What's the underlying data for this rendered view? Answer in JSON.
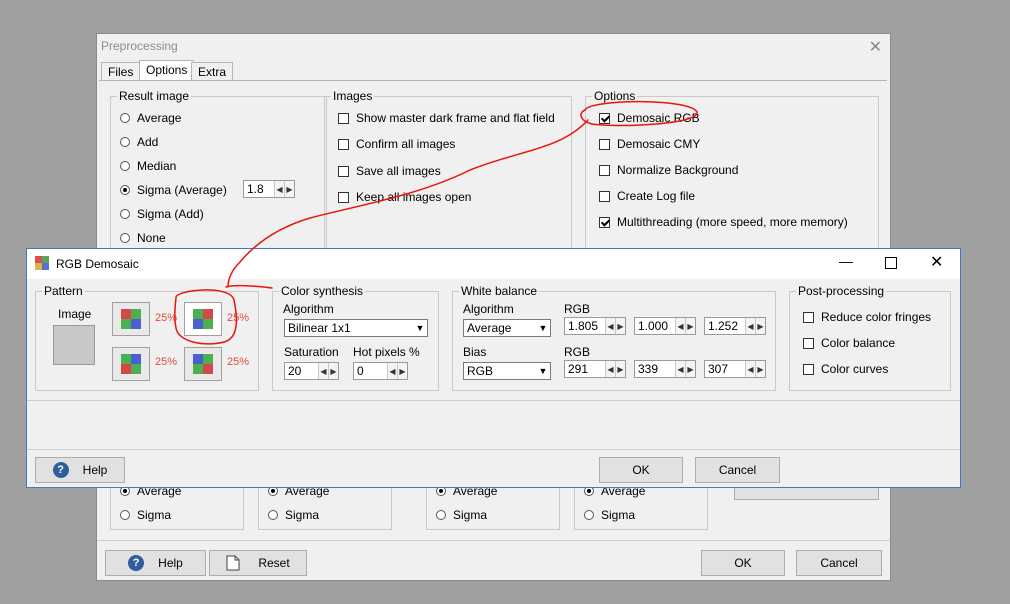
{
  "back_window": {
    "title": "Preprocessing",
    "tabs": [
      "Files",
      "Options",
      "Extra"
    ],
    "result_image": {
      "label": "Result image",
      "options": [
        "Average",
        "Add",
        "Median",
        "Sigma (Average)",
        "Sigma (Add)",
        "None"
      ],
      "selected": "Sigma (Average)",
      "sigma_value": "1.8"
    },
    "images": {
      "label": "Images",
      "checkboxes": [
        "Show master dark frame and flat field",
        "Confirm all images",
        "Save all images",
        "Keep all images open"
      ]
    },
    "options": {
      "label": "Options",
      "checkboxes": [
        "Demosaic RGB",
        "Demosaic CMY",
        "Normalize Background",
        "Create Log file",
        "Multithreading (more speed, more memory)"
      ],
      "checked": [
        true,
        false,
        false,
        false,
        true
      ]
    },
    "lower_groups": [
      {
        "average": "Average",
        "sigma": "Sigma"
      },
      {
        "average": "Average",
        "sigma": "Sigma"
      },
      {
        "average": "Average",
        "sigma": "Sigma"
      },
      {
        "average": "Average",
        "sigma": "Sigma"
      }
    ],
    "buttons": {
      "help": "Help",
      "reset": "Reset",
      "ok": "OK",
      "cancel": "Cancel"
    }
  },
  "front_window": {
    "title": "RGB Demosaic",
    "pattern": {
      "label": "Pattern",
      "image_label": "Image",
      "percents": [
        "25%",
        "25%",
        "25%",
        "25%"
      ]
    },
    "color_synthesis": {
      "label": "Color synthesis",
      "algorithm_label": "Algorithm",
      "algorithm_value": "Bilinear 1x1",
      "saturation_label": "Saturation",
      "saturation_value": "20",
      "hot_pixels_label": "Hot pixels %",
      "hot_pixels_value": "0"
    },
    "white_balance": {
      "label": "White balance",
      "algorithm_label": "Algorithm",
      "algorithm_value": "Average",
      "rgb_label_1": "RGB",
      "rgb_values_1": [
        "1.805",
        "1.000",
        "1.252"
      ],
      "bias_label": "Bias",
      "bias_value": "RGB",
      "rgb_label_2": "RGB",
      "rgb_values_2": [
        "291",
        "339",
        "307"
      ]
    },
    "post_processing": {
      "label": "Post-processing",
      "checkboxes": [
        "Reduce color fringes",
        "Color balance",
        "Color curves"
      ]
    },
    "buttons": {
      "help": "Help",
      "ok": "OK",
      "cancel": "Cancel"
    }
  },
  "colors": {
    "annotation": "#e8150e",
    "pct_text": "#e04a3c",
    "window_border": "#3f78c6"
  }
}
